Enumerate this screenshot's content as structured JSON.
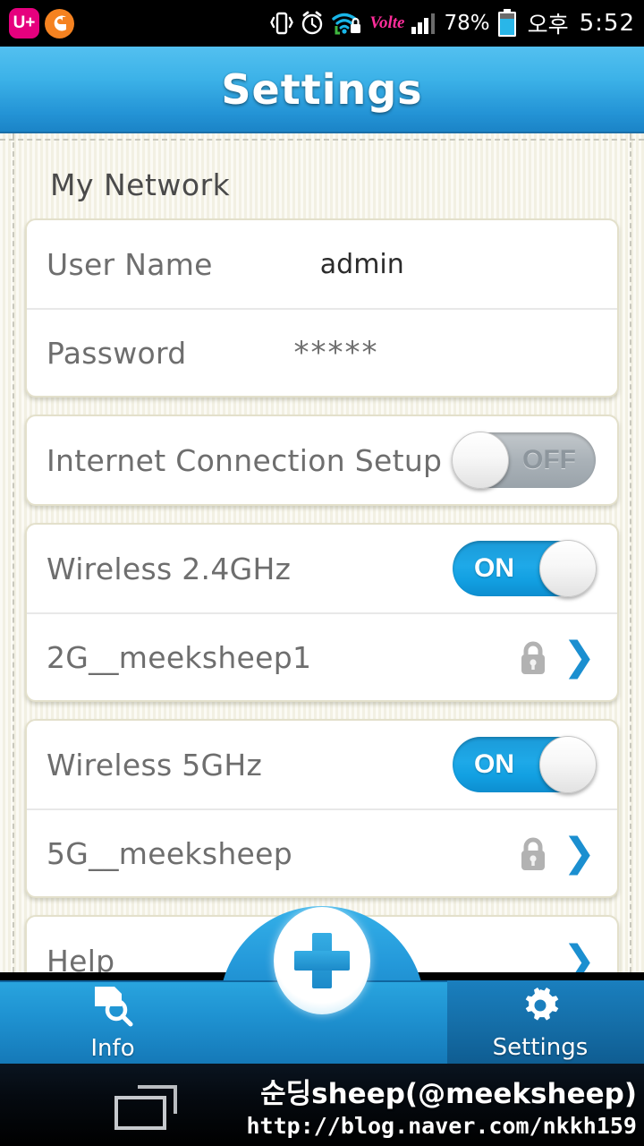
{
  "statusbar": {
    "carrier_logo": "uplus-logo",
    "carrier_text": "U+",
    "icons": [
      "vibrate-icon",
      "alarm-icon",
      "wifi-lock-icon",
      "volte-icon",
      "signal-bars-icon"
    ],
    "volte_label": "Volte",
    "battery_percent": "78%",
    "ampm": "오후",
    "time": "5:52"
  },
  "header": {
    "title": "Settings"
  },
  "main": {
    "section_title": "My Network",
    "credentials": [
      {
        "label": "User Name",
        "value": "admin"
      },
      {
        "label": "Password",
        "value": "*****"
      }
    ],
    "internet": {
      "label": "Internet Connection Setup",
      "toggle_state": "OFF"
    },
    "wireless_24": {
      "label": "Wireless 2.4GHz",
      "toggle_state": "ON",
      "ssid": "2G__meeksheep1"
    },
    "wireless_5": {
      "label": "Wireless 5GHz",
      "toggle_state": "ON",
      "ssid": "5G__meeksheep"
    },
    "help": {
      "label": "Help"
    }
  },
  "bottomnav": {
    "info_label": "Info",
    "settings_label": "Settings",
    "add_label": "+"
  },
  "watermark": {
    "line1": "순딩sheep(@meeksheep)",
    "line2": "http://blog.naver.com/nkkh159"
  },
  "colors": {
    "header_blue": "#2494d6",
    "toggle_on": "#12a0e2",
    "toggle_off": "#aab2b8",
    "chevron_blue": "#1b8fd0",
    "paper": "#fbfaf4",
    "card_border": "#e3e0cb"
  }
}
